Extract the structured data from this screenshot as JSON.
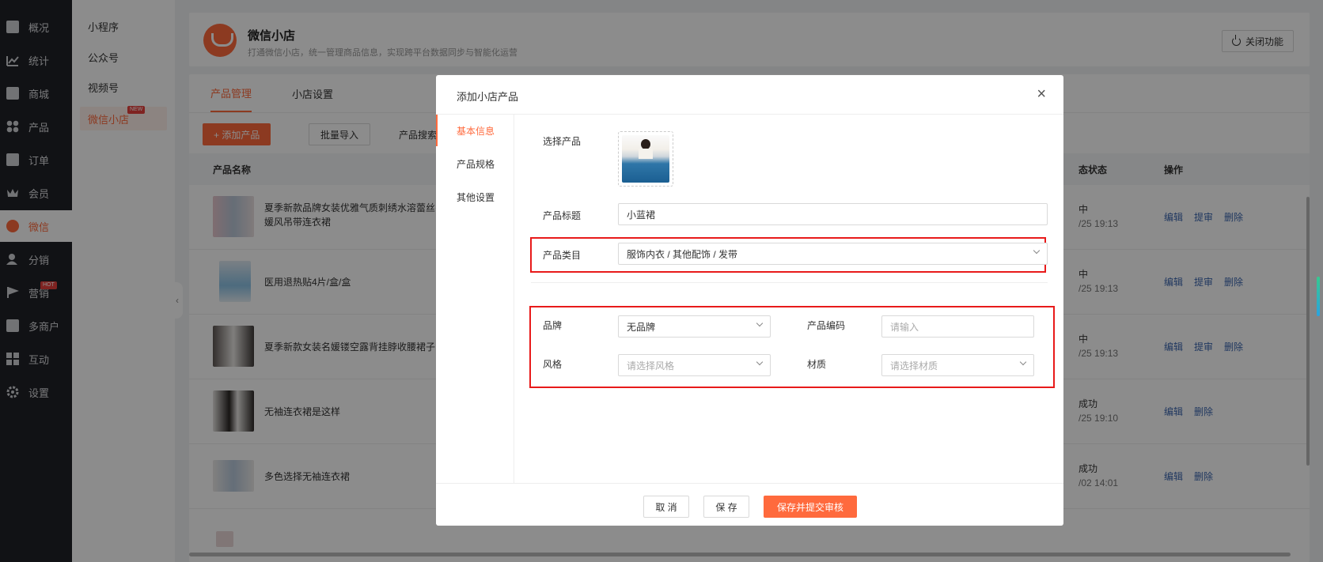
{
  "sidebar": {
    "items": [
      {
        "label": "概况",
        "icon": "stack-icon"
      },
      {
        "label": "统计",
        "icon": "chart-icon"
      },
      {
        "label": "商城",
        "icon": "mail-icon"
      },
      {
        "label": "产品",
        "icon": "grid-icon"
      },
      {
        "label": "订单",
        "icon": "clipboard-icon"
      },
      {
        "label": "会员",
        "icon": "crown-icon"
      },
      {
        "label": "微信",
        "icon": "wechat-icon"
      },
      {
        "label": "分销",
        "icon": "user-icon"
      },
      {
        "label": "营销",
        "icon": "flag-icon",
        "badge": "HOT"
      },
      {
        "label": "多商户",
        "icon": "merchant-icon"
      },
      {
        "label": "互动",
        "icon": "grid-icon"
      },
      {
        "label": "设置",
        "icon": "gear-icon"
      }
    ]
  },
  "subnav": {
    "items": [
      {
        "label": "小程序"
      },
      {
        "label": "公众号"
      },
      {
        "label": "视频号"
      },
      {
        "label": "微信小店",
        "badge": "NEW"
      }
    ]
  },
  "header": {
    "title": "微信小店",
    "subtitle": "打通微信小店，统一管理商品信息，实现跨平台数据同步与智能化运营",
    "close_button": "关闭功能"
  },
  "tabs": [
    "产品管理",
    "小店设置"
  ],
  "toolbar": {
    "add_button": "+ 添加产品",
    "import_button": "批量导入",
    "search_label": "产品搜索"
  },
  "table": {
    "headers": {
      "name": "产品名称",
      "status": "态状态",
      "ops": "操作"
    },
    "rows": [
      {
        "name": "夏季新款品牌女装优雅气质刺绣水溶蕾丝名媛风吊带连衣裙",
        "s1": "中",
        "s2": "/25 19:13",
        "ops": [
          "编辑",
          "提审",
          "删除"
        ]
      },
      {
        "name": "医用退热贴4片/盒/盒",
        "s1": "中",
        "s2": "/25 19:13",
        "ops": [
          "编辑",
          "提审",
          "删除"
        ]
      },
      {
        "name": "夏季新款女装名媛镂空露背挂脖收腰裙子",
        "s1": "中",
        "s2": "/25 19:13",
        "ops": [
          "编辑",
          "提审",
          "删除"
        ]
      },
      {
        "name": "无袖连衣裙是这样",
        "s1": "成功",
        "s2": "/25 19:10",
        "ops": [
          "编辑",
          "删除"
        ]
      },
      {
        "name": "多色选择无袖连衣裙",
        "s1": "成功",
        "s2": "/02 14:01",
        "ops": [
          "编辑",
          "删除"
        ]
      }
    ]
  },
  "modal": {
    "title": "添加小店产品",
    "nav": [
      "基本信息",
      "产品规格",
      "其他设置"
    ],
    "fields": {
      "product_label": "选择产品",
      "title_label": "产品标题",
      "title_value": "小蓝裙",
      "category_label": "产品类目",
      "category_value": "服饰内衣 / 其他配饰 / 发带",
      "brand_label": "品牌",
      "brand_value": "无品牌",
      "code_label": "产品编码",
      "code_placeholder": "请输入",
      "style_label": "风格",
      "style_placeholder": "请选择风格",
      "material_label": "材质",
      "material_placeholder": "请选择材质"
    },
    "buttons": {
      "cancel": "取 消",
      "save": "保 存",
      "submit": "保存并提交审核"
    }
  },
  "colors": {
    "accent": "#ff6a3d",
    "highlight": "#e81a1a",
    "link": "#3c67b0",
    "sidebar": "#1f2127"
  }
}
